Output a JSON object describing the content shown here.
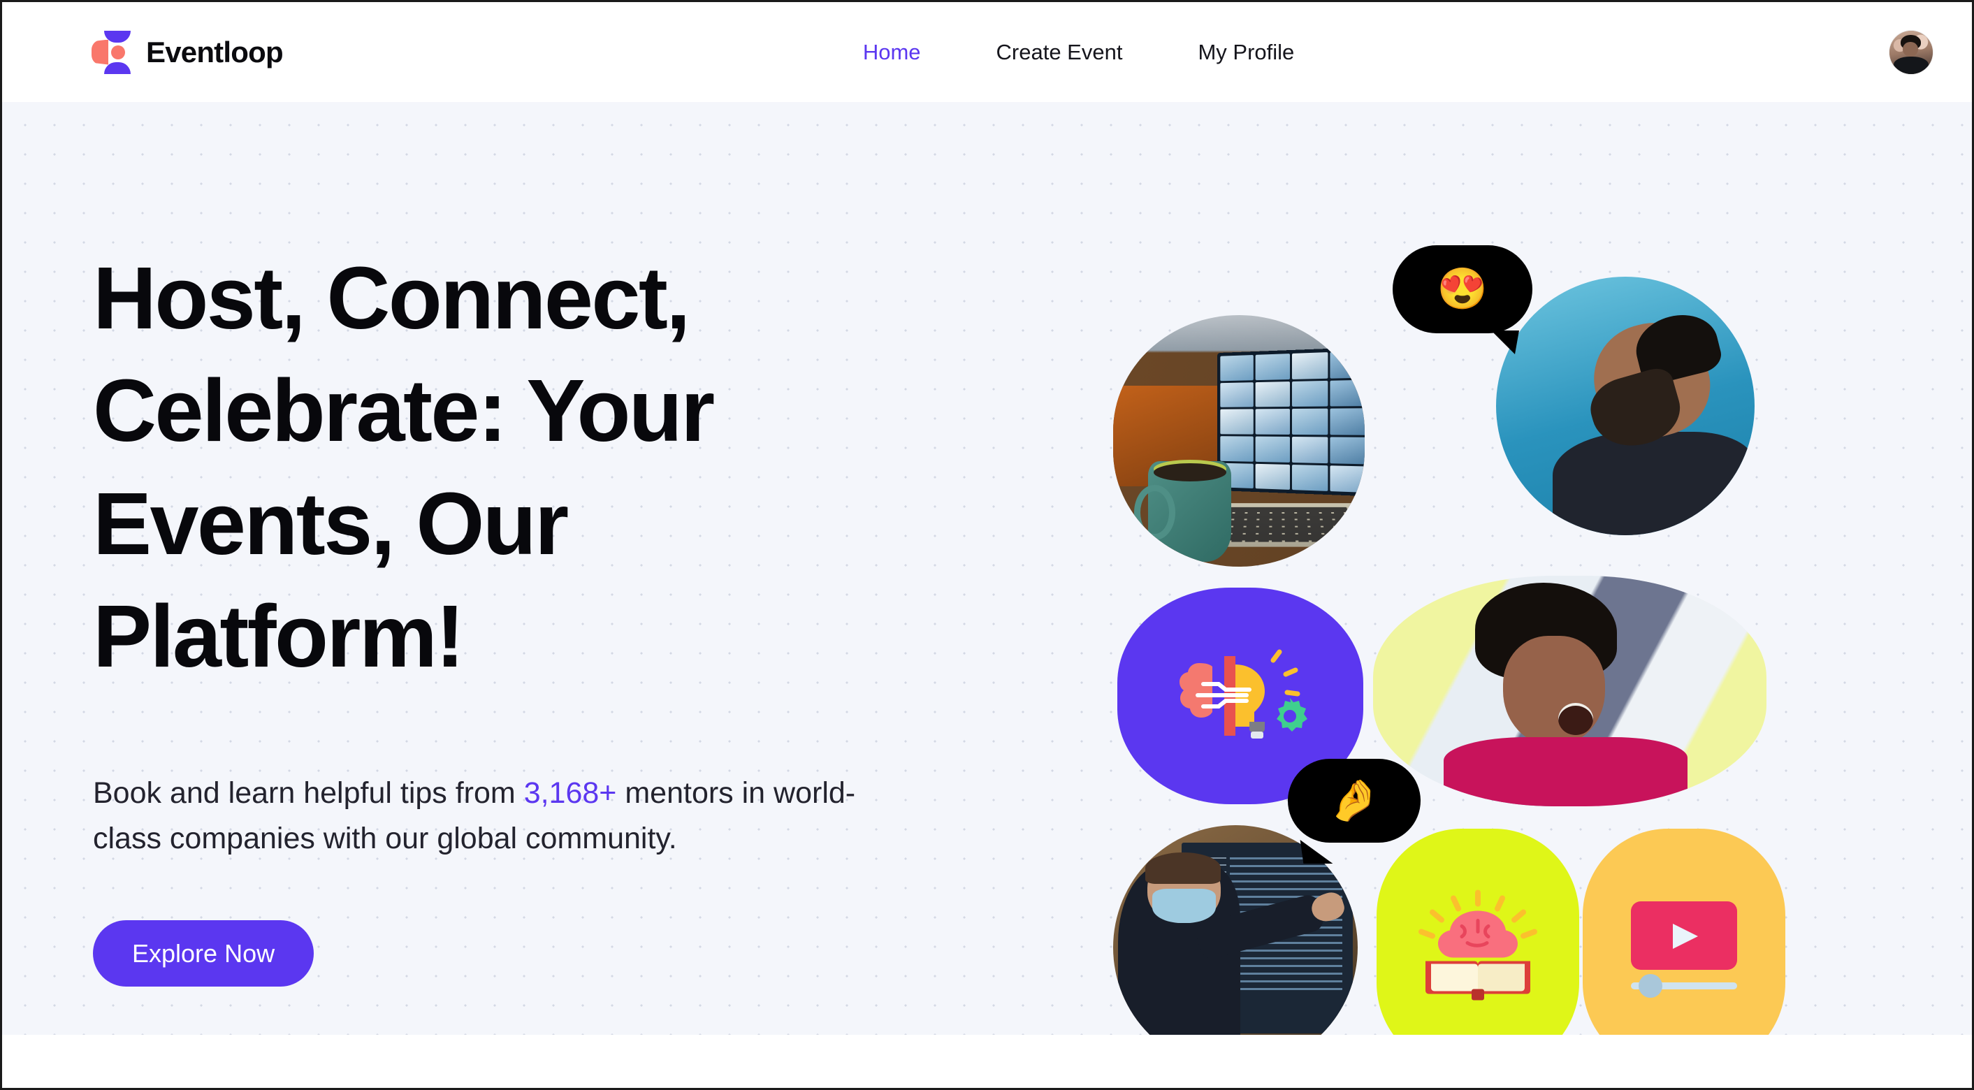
{
  "brand": {
    "name": "Eventloop",
    "logo_icon": "eventloop-logo-icon",
    "logo_colors": {
      "primary": "#5b37f0",
      "secondary": "#f9776b"
    }
  },
  "header": {
    "nav": [
      {
        "label": "Home",
        "active": true
      },
      {
        "label": "Create Event",
        "active": false
      },
      {
        "label": "My Profile",
        "active": false
      }
    ],
    "avatar_alt": "user-avatar"
  },
  "hero": {
    "headline": "Host, Connect, Celebrate: Your Events, Our Platform!",
    "subhead": {
      "before": "Book and learn helpful tips from ",
      "accent": "3,168+",
      "after": " mentors in world-class companies with our global community."
    },
    "cta_label": "Explore Now",
    "accent_color": "#5b37f0",
    "background_color": "#f4f6fb",
    "dot_grid": true
  },
  "collage": {
    "tiles": [
      {
        "name": "video-call-photo",
        "kind": "photo",
        "caption": "laptop video call with green mug"
      },
      {
        "name": "laughing-man-photo",
        "kind": "photo",
        "caption": "man laughing against blue sky"
      },
      {
        "name": "idea-illustration",
        "kind": "illustration",
        "caption": "brain lightbulb gear",
        "bg": "#5b37f0"
      },
      {
        "name": "laughing-woman-photo",
        "kind": "photo",
        "caption": "woman laughing in pink top"
      },
      {
        "name": "code-mentor-photo",
        "kind": "photo",
        "caption": "masked person pointing at code screen"
      },
      {
        "name": "book-brain-illustration",
        "kind": "illustration",
        "caption": "brain rising from open book",
        "bg": "#dff618"
      },
      {
        "name": "video-player-illustration",
        "kind": "illustration",
        "caption": "video player with play button",
        "bg": "#fcc954"
      }
    ],
    "bubbles": [
      {
        "name": "heart-eyes-bubble",
        "emoji": "😍"
      },
      {
        "name": "pinched-fingers-bubble",
        "emoji": "🤌"
      }
    ]
  }
}
